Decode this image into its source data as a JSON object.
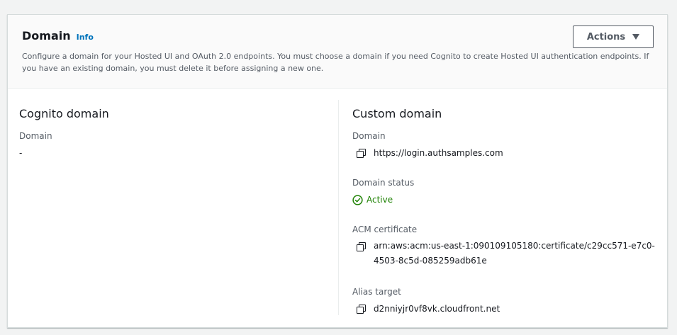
{
  "header": {
    "title": "Domain",
    "info_label": "Info",
    "description": "Configure a domain for your Hosted UI and OAuth 2.0 endpoints. You must choose a domain if you need Cognito to create Hosted UI authentication endpoints. If you have an existing domain, you must delete it before assigning a new one.",
    "actions_label": "Actions"
  },
  "cognito_domain": {
    "title": "Cognito domain",
    "domain_label": "Domain",
    "domain_value": "-"
  },
  "custom_domain": {
    "title": "Custom domain",
    "domain_label": "Domain",
    "domain_value": "https://login.authsamples.com",
    "status_label": "Domain status",
    "status_value": "Active",
    "acm_label": "ACM certificate",
    "acm_value": "arn:aws:acm:us-east-1:090109105180:certificate/c29cc571-e7c0-4503-8c5d-085259adb61e",
    "alias_label": "Alias target",
    "alias_value": "d2nniyjr0vf8vk.cloudfront.net"
  },
  "icons": {
    "copy": "copy-icon",
    "status": "check-circle-icon",
    "dropdown": "caret-down-icon"
  },
  "colors": {
    "link": "#0073bb",
    "success": "#1d8102",
    "border": "#d5dbdb"
  }
}
